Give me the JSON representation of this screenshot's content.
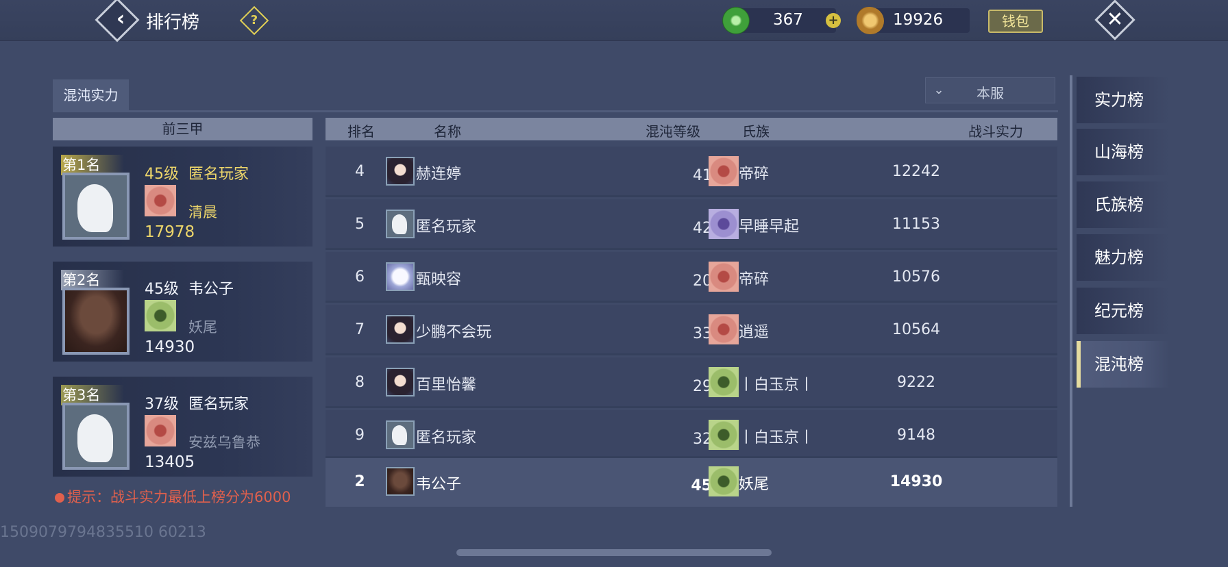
{
  "header": {
    "title": "排行榜",
    "jade": "367",
    "coins": "19926",
    "wallet_label": "钱包"
  },
  "tabs": [
    "混沌实力"
  ],
  "server_filter": "本服",
  "top3": {
    "header": "前三甲",
    "cards": [
      {
        "rank_label": "第1名",
        "level": "45级",
        "name": "匿名玩家",
        "clan": "清晨",
        "power": "17978"
      },
      {
        "rank_label": "第2名",
        "level": "45级",
        "name": "韦公子",
        "clan": "妖尾",
        "power": "14930"
      },
      {
        "rank_label": "第3名",
        "level": "37级",
        "name": "匿名玩家",
        "clan": "安兹乌鲁恭",
        "power": "13405"
      }
    ]
  },
  "table": {
    "columns": [
      "排名",
      "名称",
      "混沌等级",
      "氏族",
      "战斗实力"
    ],
    "rows": [
      {
        "rank": "4",
        "name": "赫连婷",
        "level": "41级",
        "clan": "帝碎",
        "power": "12242"
      },
      {
        "rank": "5",
        "name": "匿名玩家",
        "level": "42级",
        "clan": "早睡早起",
        "power": "11153"
      },
      {
        "rank": "6",
        "name": "甄映容",
        "level": "20级",
        "clan": "帝碎",
        "power": "10576"
      },
      {
        "rank": "7",
        "name": "少鹏不会玩",
        "level": "33级",
        "clan": "逍遥",
        "power": "10564"
      },
      {
        "rank": "8",
        "name": "百里怡馨",
        "level": "29级",
        "clan": "丨白玉京丨",
        "power": "9222"
      },
      {
        "rank": "9",
        "name": "匿名玩家",
        "level": "32级",
        "clan": "丨白玉京丨",
        "power": "9148"
      }
    ],
    "self_row": {
      "rank": "2",
      "name": "韦公子",
      "level": "45级",
      "clan": "妖尾",
      "power": "14930"
    }
  },
  "hint": "提示：战斗实力最低上榜分为6000",
  "uid": "1509079794835510 60213",
  "side_menu": [
    "实力榜",
    "山海榜",
    "氏族榜",
    "魅力榜",
    "纪元榜",
    "混沌榜"
  ],
  "side_menu_active": "混沌榜",
  "colors": {
    "accent_gold": "#ecd56a",
    "hint_red": "#e0604d",
    "background": "#3f4a68"
  }
}
